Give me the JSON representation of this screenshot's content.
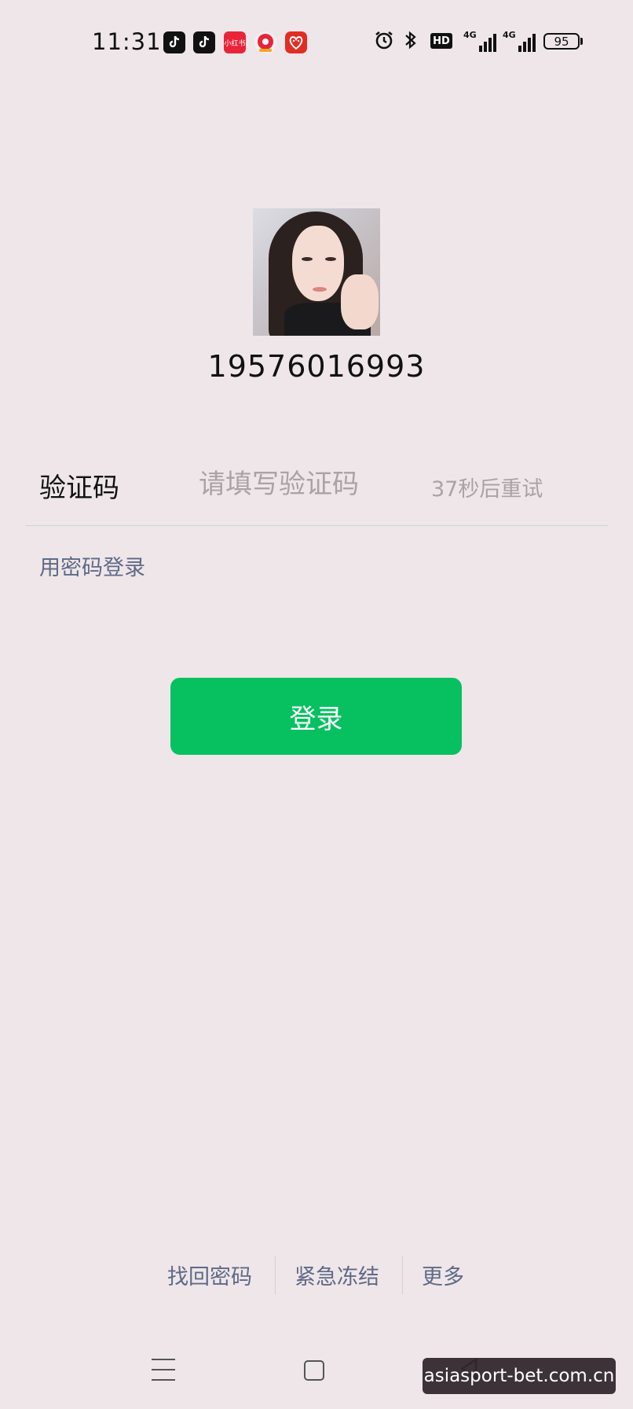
{
  "status_bar": {
    "time": "11:31",
    "apps": [
      "tiktok-icon",
      "tiktok-lite-icon",
      "xiaohongshu-icon",
      "video-app-icon",
      "pinduoduo-icon"
    ],
    "xiaohongshu_label": "小红书",
    "hd_label": "HD",
    "network_1": "4G",
    "network_2": "4G",
    "battery": "95"
  },
  "profile": {
    "phone": "19576016993"
  },
  "code_row": {
    "label": "验证码",
    "placeholder": "请填写验证码",
    "resend": "37秒后重试"
  },
  "password_login": "用密码登录",
  "login_button": "登录",
  "bottom_links": {
    "recover": "找回密码",
    "freeze": "紧急冻结",
    "more": "更多"
  },
  "watermark": "asiasport-bet.com.cn",
  "colors": {
    "background": "#efe6e9",
    "primary": "#07c160",
    "link": "#5f6a86",
    "placeholder": "#a9a3a6"
  }
}
